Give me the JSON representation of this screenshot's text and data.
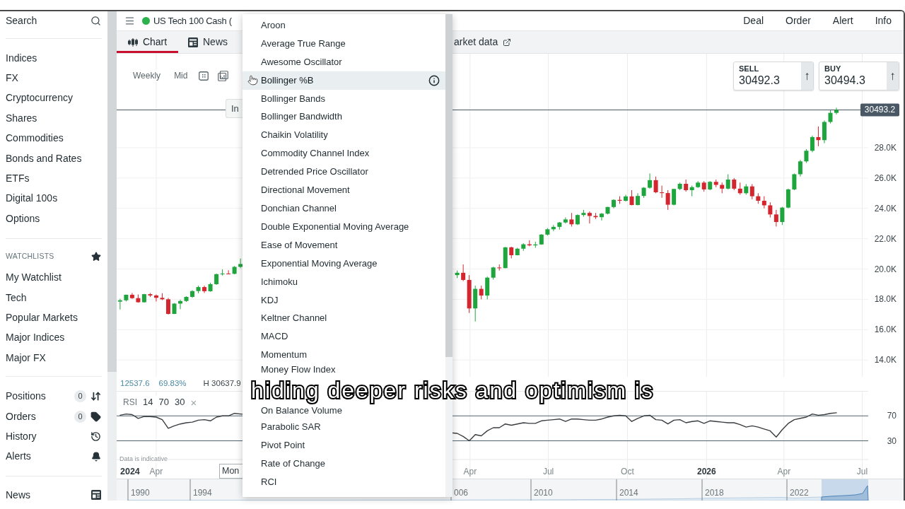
{
  "top_bar": {
    "market_open": true,
    "instrument": "US Tech 100 Cash (",
    "actions": [
      "Deal",
      "Order",
      "Alert",
      "Info"
    ]
  },
  "sidebar": {
    "search": "Search",
    "markets": [
      "Indices",
      "FX",
      "Cryptocurrency",
      "Shares",
      "Commodities",
      "Bonds and Rates",
      "ETFs",
      "Digital 100s",
      "Options"
    ],
    "watchlists": {
      "title": "WATCHLISTS",
      "items": [
        "My Watchlist",
        "Tech",
        "Popular Markets",
        "Major Indices",
        "Major FX"
      ]
    },
    "account": [
      {
        "label": "Positions",
        "count": "0",
        "kind": "positions"
      },
      {
        "label": "Orders",
        "count": "0",
        "kind": "orders"
      },
      {
        "label": "History",
        "kind": "history"
      },
      {
        "label": "Alerts",
        "kind": "alerts"
      }
    ],
    "footer": [
      {
        "label": "News",
        "kind": "news"
      }
    ]
  },
  "tabs": [
    {
      "label": "Chart",
      "kind": "chart",
      "selected": true
    },
    {
      "label": "News",
      "kind": "news",
      "selected": false
    },
    {
      "label": "arket data",
      "kind": "external",
      "selected": false
    }
  ],
  "chart": {
    "toolbar": {
      "interval": "Weekly",
      "price": "Mid"
    },
    "tooltip": "In",
    "quotes": [
      {
        "label": "SELL",
        "price": "30492.3",
        "arrow": "↑"
      },
      {
        "label": "BUY",
        "price": "30494.3",
        "arrow": "↑"
      }
    ],
    "stats": [
      {
        "text": "12537.6",
        "kind": "change"
      },
      {
        "text": "69.83%",
        "kind": "change"
      },
      {
        "text": "H 30637.9",
        "kind": "high"
      }
    ],
    "rsi_legend": {
      "name": "RSI",
      "params": [
        "14",
        "70",
        "30"
      ],
      "close": "×"
    },
    "disclaimer": "Data is indicative",
    "axis_year": "2024",
    "crosshair_date": "Mon",
    "chart_data": [
      {
        "type": "candlestick",
        "x": [
          "2024-02-19",
          "2024-02-26",
          "2024-03-04",
          "2024-03-11",
          "2024-03-18",
          "2024-03-25",
          "2024-04-01",
          "2024-04-08",
          "2024-04-15",
          "2024-04-22",
          "2024-04-29",
          "2024-05-06",
          "2024-05-13",
          "2024-05-20",
          "2024-05-27",
          "2024-06-03",
          "2024-06-10",
          "2024-06-17",
          "2024-06-24",
          "2024-07-01",
          "2024-07-08",
          "2025-03-17",
          "2025-03-24",
          "2025-03-31",
          "2025-04-07",
          "2025-04-14",
          "2025-04-21",
          "2025-04-28",
          "2025-05-05",
          "2025-05-12",
          "2025-05-19",
          "2025-05-26",
          "2025-06-02",
          "2025-06-09",
          "2025-06-16",
          "2025-06-23",
          "2025-06-30",
          "2025-07-07",
          "2025-07-14",
          "2025-07-21",
          "2025-07-28",
          "2025-08-04",
          "2025-08-11",
          "2025-08-18",
          "2025-08-25",
          "2025-09-01",
          "2025-09-08",
          "2025-09-15",
          "2025-09-22",
          "2025-09-29",
          "2025-10-06",
          "2025-10-13",
          "2025-10-20",
          "2025-10-27",
          "2025-11-03",
          "2025-11-10",
          "2025-11-17",
          "2025-11-24",
          "2025-12-01",
          "2025-12-08",
          "2025-12-15",
          "2025-12-22",
          "2025-12-29",
          "2026-01-05",
          "2026-01-12",
          "2026-01-19",
          "2026-01-26",
          "2026-02-02",
          "2026-02-09",
          "2026-02-16",
          "2026-02-23",
          "2026-03-02",
          "2026-03-09",
          "2026-03-16",
          "2026-03-23",
          "2026-03-30",
          "2026-04-06",
          "2026-04-13",
          "2026-04-20",
          "2026-04-27",
          "2026-05-04",
          "2026-05-11",
          "2026-05-18",
          "2026-05-25",
          "2026-06-01"
        ],
        "ohlc": [
          [
            17850,
            18040,
            17330,
            17937
          ],
          [
            17937,
            18310,
            17860,
            18302
          ],
          [
            18302,
            18420,
            18030,
            18078
          ],
          [
            18078,
            18320,
            17780,
            17808
          ],
          [
            17808,
            18360,
            17780,
            18340
          ],
          [
            18340,
            18420,
            18150,
            18255
          ],
          [
            18255,
            18320,
            17860,
            18100
          ],
          [
            18100,
            18400,
            17950,
            18003
          ],
          [
            18003,
            18090,
            17000,
            17037
          ],
          [
            17037,
            17750,
            17030,
            17718
          ],
          [
            17718,
            17980,
            17350,
            17890
          ],
          [
            17890,
            18200,
            17830,
            18161
          ],
          [
            18161,
            18600,
            18100,
            18546
          ],
          [
            18546,
            18900,
            18400,
            18808
          ],
          [
            18808,
            18900,
            18420,
            18536
          ],
          [
            18536,
            19100,
            18500,
            19000
          ],
          [
            19000,
            19700,
            18950,
            19660
          ],
          [
            19660,
            19980,
            19570,
            19700
          ],
          [
            19700,
            19920,
            19650,
            19683
          ],
          [
            19683,
            20200,
            19650,
            20140
          ],
          [
            20140,
            20690,
            20060,
            20330
          ],
          [
            19600,
            19900,
            19400,
            19750
          ],
          [
            19750,
            20300,
            19200,
            19280
          ],
          [
            19280,
            19600,
            17100,
            17400
          ],
          [
            17400,
            18900,
            16540,
            18690
          ],
          [
            18690,
            18900,
            18000,
            18250
          ],
          [
            18250,
            19500,
            18000,
            19430
          ],
          [
            19430,
            20150,
            19300,
            20100
          ],
          [
            20100,
            20300,
            19900,
            20060
          ],
          [
            20060,
            21450,
            20050,
            21430
          ],
          [
            21430,
            21470,
            20700,
            20910
          ],
          [
            20910,
            21400,
            20900,
            21340
          ],
          [
            21340,
            21700,
            21200,
            21630
          ],
          [
            21630,
            21900,
            21500,
            21560
          ],
          [
            21560,
            21800,
            21400,
            21620
          ],
          [
            21620,
            22300,
            21600,
            22270
          ],
          [
            22270,
            22700,
            22200,
            22620
          ],
          [
            22620,
            22900,
            22500,
            22780
          ],
          [
            22780,
            23100,
            22600,
            23070
          ],
          [
            23070,
            23400,
            23000,
            23270
          ],
          [
            23270,
            23700,
            22800,
            22950
          ],
          [
            22950,
            23600,
            22900,
            23560
          ],
          [
            23560,
            23900,
            23450,
            23700
          ],
          [
            23700,
            23800,
            23000,
            23500
          ],
          [
            23500,
            23700,
            23300,
            23420
          ],
          [
            23420,
            23700,
            23200,
            23650
          ],
          [
            23650,
            24100,
            23600,
            24090
          ],
          [
            24090,
            24600,
            24000,
            24560
          ],
          [
            24560,
            24800,
            24300,
            24500
          ],
          [
            24500,
            24900,
            24450,
            24790
          ],
          [
            24790,
            25200,
            24200,
            24220
          ],
          [
            24220,
            25000,
            24200,
            24820
          ],
          [
            24820,
            25400,
            24700,
            25360
          ],
          [
            25360,
            26300,
            25300,
            25860
          ],
          [
            25860,
            26100,
            25000,
            25060
          ],
          [
            25060,
            25500,
            24700,
            25010
          ],
          [
            25010,
            25200,
            23900,
            24240
          ],
          [
            24240,
            25300,
            24200,
            25280
          ],
          [
            25280,
            25700,
            25200,
            25620
          ],
          [
            25620,
            25900,
            25100,
            25200
          ],
          [
            25200,
            25500,
            24800,
            25400
          ],
          [
            25400,
            25800,
            25350,
            25700
          ],
          [
            25700,
            25800,
            25100,
            25250
          ],
          [
            25250,
            25800,
            25200,
            25750
          ],
          [
            25750,
            25900,
            25400,
            25550
          ],
          [
            25550,
            25700,
            25000,
            25300
          ],
          [
            25300,
            26250,
            25250,
            25900
          ],
          [
            25900,
            26000,
            25200,
            25300
          ],
          [
            25300,
            25700,
            24900,
            25000
          ],
          [
            25000,
            25600,
            24900,
            25450
          ],
          [
            25450,
            25600,
            24600,
            24800
          ],
          [
            24800,
            25000,
            24300,
            24500
          ],
          [
            24500,
            24800,
            24000,
            24200
          ],
          [
            24200,
            24400,
            23400,
            23600
          ],
          [
            23600,
            23900,
            22800,
            23100
          ],
          [
            23100,
            24100,
            22900,
            24050
          ],
          [
            24050,
            25300,
            24000,
            25250
          ],
          [
            25250,
            26300,
            25200,
            26250
          ],
          [
            26250,
            27200,
            26100,
            27100
          ],
          [
            27100,
            27900,
            27000,
            27800
          ],
          [
            27800,
            28800,
            27700,
            28700
          ],
          [
            28700,
            29400,
            28100,
            28500
          ],
          [
            28500,
            29800,
            28300,
            29700
          ],
          [
            29700,
            30500,
            29600,
            30300
          ],
          [
            30300,
            30640,
            30200,
            30493
          ]
        ],
        "xlim": [
          "2024-02-15",
          "2026-07-08"
        ],
        "ylim": [
          12890,
          34200
        ],
        "yticks": [
          {
            "value": 14000,
            "label": "14.0K"
          },
          {
            "value": 16000,
            "label": "16.0K"
          },
          {
            "value": 18000,
            "label": "18.0K"
          },
          {
            "value": 20000,
            "label": "20.0K"
          },
          {
            "value": 22000,
            "label": "22.0K"
          },
          {
            "value": 24000,
            "label": "24.0K"
          },
          {
            "value": 26000,
            "label": "26.0K"
          },
          {
            "value": 28000,
            "label": "28.0K"
          }
        ],
        "xticks": [
          "2024-04-01",
          "2025-04-01",
          "2025-07-01",
          "2025-10-01",
          "2026-01-01",
          "2026-04-01",
          "2026-07-01"
        ],
        "tick_labels": "y",
        "grid": true,
        "ref_lines": [
          {
            "axis": "y",
            "value": 30493.2,
            "label": "30493.2",
            "color": "#4a5866"
          }
        ]
      },
      {
        "type": "line",
        "x": [
          "2024-02-19",
          "2024-02-26",
          "2024-03-04",
          "2024-03-11",
          "2024-03-18",
          "2024-03-25",
          "2024-04-01",
          "2024-04-08",
          "2024-04-15",
          "2024-04-22",
          "2024-04-29",
          "2024-05-06",
          "2024-05-13",
          "2024-05-20",
          "2024-05-27",
          "2024-06-03",
          "2024-06-10",
          "2024-06-17",
          "2024-06-24",
          "2024-07-01",
          "2024-07-08",
          "2025-03-17",
          "2025-03-24",
          "2025-03-31",
          "2025-04-07",
          "2025-04-14",
          "2025-04-21",
          "2025-04-28",
          "2025-05-05",
          "2025-05-12",
          "2025-05-19",
          "2025-05-26",
          "2025-06-02",
          "2025-06-09",
          "2025-06-16",
          "2025-06-23",
          "2025-06-30",
          "2025-07-07",
          "2025-07-14",
          "2025-07-21",
          "2025-07-28",
          "2025-08-04",
          "2025-08-11",
          "2025-08-18",
          "2025-08-25",
          "2025-09-01",
          "2025-09-08",
          "2025-09-15",
          "2025-09-22",
          "2025-09-29",
          "2025-10-06",
          "2025-10-13",
          "2025-10-20",
          "2025-10-27",
          "2025-11-03",
          "2025-11-10",
          "2025-11-17",
          "2025-11-24",
          "2025-12-01",
          "2025-12-08",
          "2025-12-15",
          "2025-12-22",
          "2025-12-29",
          "2026-01-05",
          "2026-01-12",
          "2026-01-19",
          "2026-01-26",
          "2026-02-02",
          "2026-02-09",
          "2026-02-16",
          "2026-02-23",
          "2026-03-02",
          "2026-03-09",
          "2026-03-16",
          "2026-03-23",
          "2026-03-30",
          "2026-04-06",
          "2026-04-13",
          "2026-04-20",
          "2026-04-27",
          "2026-05-04",
          "2026-05-11",
          "2026-05-18",
          "2026-05-25",
          "2026-06-01"
        ],
        "values": [
          71,
          73,
          72,
          66,
          69,
          69,
          68,
          64,
          50,
          54,
          57,
          59,
          60,
          63,
          64,
          62,
          68,
          70,
          70,
          74,
          73,
          42,
          37,
          30,
          40,
          38,
          46,
          51,
          51,
          57,
          55,
          57,
          59,
          58,
          58,
          62,
          63,
          64,
          65,
          61,
          65,
          65,
          64,
          63,
          63,
          65,
          68,
          70,
          71,
          70,
          61,
          66,
          70,
          71,
          64,
          63,
          57,
          63,
          64,
          59,
          61,
          62,
          58,
          62,
          61,
          60,
          59,
          59,
          56,
          52,
          54,
          52,
          49,
          46,
          36,
          48,
          58,
          64,
          66,
          68,
          73,
          71,
          72,
          74,
          75
        ],
        "color": "#3a3d40",
        "xlim": [
          "2024-02-15",
          "2026-07-08"
        ],
        "ylim": [
          0,
          110
        ],
        "yticks": [
          30,
          70
        ],
        "grid": true,
        "xticks": [
          {
            "value": "2024-04-01",
            "label": "Apr"
          },
          {
            "value": "2025-04-01",
            "label": "Apr"
          },
          {
            "value": "2025-07-01",
            "label": "Jul"
          },
          {
            "value": "2025-10-01",
            "label": "Oct"
          },
          {
            "value": "2026-01-01",
            "label": "2026"
          },
          {
            "value": "2026-04-01",
            "label": "Apr"
          },
          {
            "value": "2026-07-01",
            "label": "Jul"
          }
        ],
        "ref_lines": [
          {
            "axis": "y",
            "value": 70,
            "color": "#52636e"
          },
          {
            "axis": "y",
            "value": 30,
            "color": "#52636e"
          }
        ]
      }
    ],
    "navigator": {
      "years": [
        "1990",
        "1994",
        "006",
        "2010",
        "2014",
        "2018",
        "2022"
      ]
    }
  },
  "indicator_menu": {
    "items": [
      {
        "label": "Aroon",
        "kind": "option",
        "hovered": false
      },
      {
        "label": "Average True Range",
        "kind": "option",
        "hovered": false
      },
      {
        "label": "Awesome Oscillator",
        "kind": "option",
        "hovered": false
      },
      {
        "label": "Bollinger %B",
        "kind": "option",
        "hovered": true
      },
      {
        "label": "Bollinger Bands",
        "kind": "option",
        "hovered": false
      },
      {
        "label": "Bollinger Bandwidth",
        "kind": "option",
        "hovered": false
      },
      {
        "label": "Chaikin Volatility",
        "kind": "option",
        "hovered": false
      },
      {
        "label": "Commodity Channel Index",
        "kind": "option",
        "hovered": false
      },
      {
        "label": "Detrended Price Oscillator",
        "kind": "option",
        "hovered": false
      },
      {
        "label": "Directional Movement",
        "kind": "option",
        "hovered": false
      },
      {
        "label": "Donchian Channel",
        "kind": "option",
        "hovered": false
      },
      {
        "label": "Double Exponential Moving Average",
        "kind": "option",
        "hovered": false
      },
      {
        "label": "Ease of Movement",
        "kind": "option",
        "hovered": false
      },
      {
        "label": "Exponential Moving Average",
        "kind": "option",
        "hovered": false
      },
      {
        "label": "Ichimoku",
        "kind": "option",
        "hovered": false
      },
      {
        "label": "KDJ",
        "kind": "option",
        "hovered": false
      },
      {
        "label": "Keltner Channel",
        "kind": "option",
        "hovered": false
      },
      {
        "label": "MACD",
        "kind": "option",
        "hovered": false
      },
      {
        "label": "Momentum",
        "kind": "option",
        "hovered": false
      },
      {
        "label": "Money Flow Index",
        "kind": "option",
        "hovered": false
      },
      {
        "kind": "covered"
      },
      {
        "label": "On Balance Volume",
        "kind": "option",
        "hovered": false
      },
      {
        "label": "Parabolic SAR",
        "kind": "option",
        "hovered": false
      },
      {
        "label": "Pivot Point",
        "kind": "option",
        "hovered": false
      },
      {
        "label": "Rate of Change",
        "kind": "option",
        "hovered": false
      },
      {
        "label": "RCI",
        "kind": "option",
        "hovered": false
      }
    ]
  },
  "caption": "hiding deeper risks and optimism is"
}
